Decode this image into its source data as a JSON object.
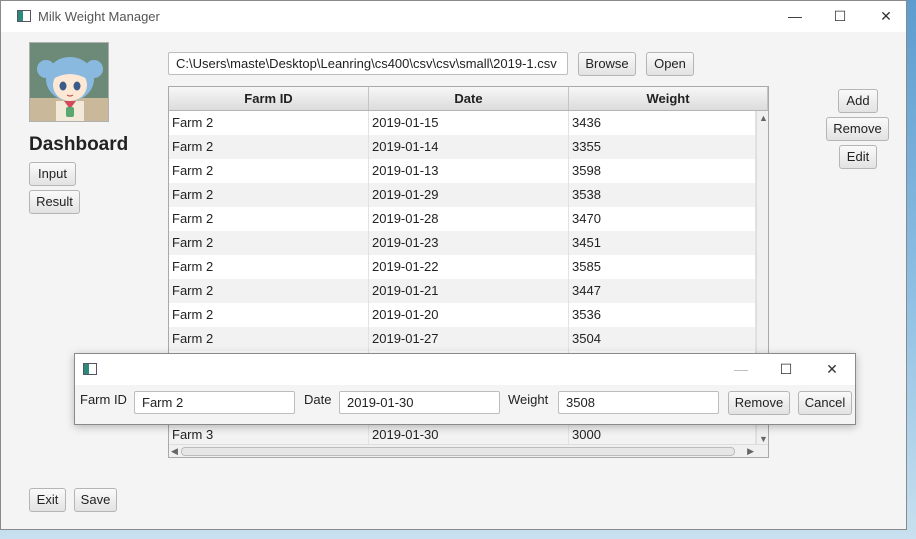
{
  "window": {
    "title": "Milk Weight Manager"
  },
  "sidebar": {
    "dashboard_title": "Dashboard",
    "input_label": "Input",
    "result_label": "Result",
    "exit_label": "Exit",
    "save_label": "Save"
  },
  "toolbar": {
    "file_path": "C:\\Users\\maste\\Desktop\\Leanring\\cs400\\csv\\csv\\small\\2019-1.csv",
    "browse_label": "Browse",
    "open_label": "Open"
  },
  "actions": {
    "add_label": "Add",
    "remove_label": "Remove",
    "edit_label": "Edit"
  },
  "table": {
    "columns": [
      "Farm ID",
      "Date",
      "Weight"
    ],
    "rows": [
      [
        "Farm 2",
        "2019-01-15",
        "3436"
      ],
      [
        "Farm 2",
        "2019-01-14",
        "3355"
      ],
      [
        "Farm 2",
        "2019-01-13",
        "3598"
      ],
      [
        "Farm 2",
        "2019-01-29",
        "3538"
      ],
      [
        "Farm 2",
        "2019-01-28",
        "3470"
      ],
      [
        "Farm 2",
        "2019-01-23",
        "3451"
      ],
      [
        "Farm 2",
        "2019-01-22",
        "3585"
      ],
      [
        "Farm 2",
        "2019-01-21",
        "3447"
      ],
      [
        "Farm 2",
        "2019-01-20",
        "3536"
      ],
      [
        "Farm 2",
        "2019-01-27",
        "3504"
      ],
      [
        "",
        "",
        ""
      ],
      [
        "",
        "",
        ""
      ],
      [
        "",
        "",
        ""
      ],
      [
        "Farm 3",
        "2019-01-30",
        "3000"
      ]
    ]
  },
  "dialog": {
    "farm_label": "Farm ID",
    "farm_value": "Farm 2",
    "date_label": "Date",
    "date_value": "2019-01-30",
    "weight_label": "Weight",
    "weight_value": "3508",
    "remove_label": "Remove",
    "cancel_label": "Cancel"
  },
  "colors": {
    "window_bg": "#f4f4f4",
    "desktop_blue": "#5d9ccf"
  }
}
